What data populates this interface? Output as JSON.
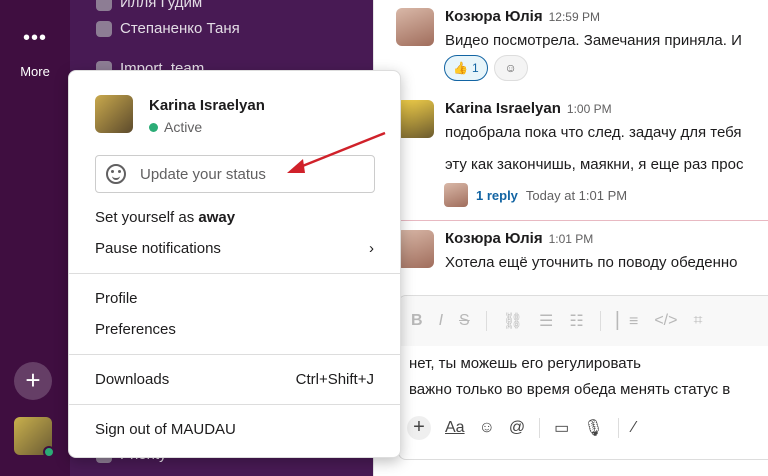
{
  "rail": {
    "more_label": "More",
    "dots": "•••"
  },
  "sidebar": {
    "rows": [
      "Илля Гудим",
      "Степаненко Таня",
      "Import_team",
      "Priority"
    ]
  },
  "messages": [
    {
      "name": "Козюра Юлія",
      "time": "12:59 PM",
      "text": "Видео посмотрела. Замечания приняла. И"
    },
    {
      "name": "Karina Israelyan",
      "time": "1:00 PM",
      "text1": "подобрала пока что след. задачу для тебя",
      "text2": "эту как закончишь, маякни, я еще раз прос"
    },
    {
      "name": "Козюра Юлія",
      "time": "1:01 PM",
      "text": "Хотела ещё уточнить по поводу обеденно"
    }
  ],
  "reactions": {
    "thumbs": "👍",
    "count": "1",
    "add_icon": "emoji-add"
  },
  "thread": {
    "reply": "1 reply",
    "timestamp": "Today at 1:01 PM"
  },
  "composer": {
    "line1": "нет, ты можешь его регулировать",
    "line2": "важно только во время обеда менять статус в "
  },
  "popup": {
    "name": "Karina Israelyan",
    "status": "Active",
    "status_placeholder": "Update your status",
    "away_prefix": "Set yourself as ",
    "away_bold": "away",
    "pause": "Pause notifications",
    "pause_chevron": "›",
    "profile": "Profile",
    "preferences": "Preferences",
    "downloads": "Downloads",
    "downloads_shortcut": "Ctrl+Shift+J",
    "signout": "Sign out of MAUDAU"
  },
  "colors": {
    "rail": "#3f0e40",
    "sidebar": "#481a54",
    "active": "#2bac76",
    "link": "#1264a3",
    "arrow": "#d0212a"
  }
}
